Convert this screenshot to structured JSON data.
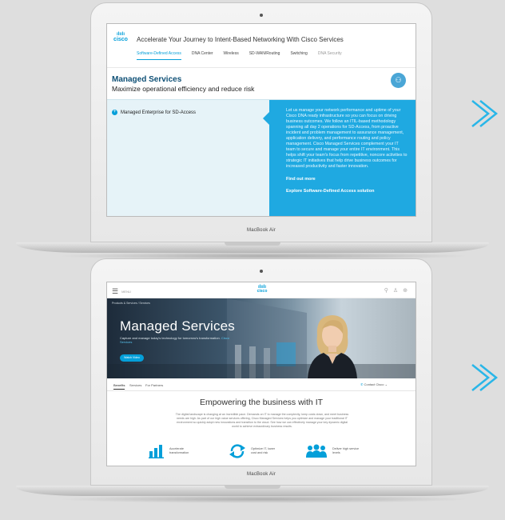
{
  "laptops": [
    {
      "brand": "MacBook Air",
      "screen": {
        "logo_text": "cisco",
        "logo_bars": "ılıılı",
        "title": "Accelerate Your Journey to Intent-Based Networking With Cisco Services",
        "tabs": [
          "Software-Defined Access",
          "DNA Center",
          "Wireless",
          "SD-WAN/Routing",
          "Switching",
          "DNA Security"
        ],
        "heading": "Managed Services",
        "subheading": "Maximize operational efficiency and reduce risk",
        "badge_icon": "people-icon",
        "badge_glyph": "⚇",
        "accordion_item_icon": "+",
        "accordion_item": "Managed Enterprise for SD-Access",
        "description": "Let us manage your network performance and uptime of your Cisco DNA ready infrastructure so you can focus on driving business outcomes. We follow an ITIL-based methodology spanning all day 2 operations for SD-Access, from proactive incident and problem management to assurance management, application delivery, and performance routing and policy management. Cisco Managed Services complement your IT team to secure and manage your entire IT environment. This helps shift your team's focus from repetitive, noncore activities to strategic IT initiatives that help drive business outcomes for increased productivity and faster innovation.",
        "link_find_out": "Find out more",
        "link_explore": "Explore Software-Defined Access solution"
      }
    },
    {
      "brand": "MacBook Air",
      "screen": {
        "menu_glyph": "☰",
        "menu_label": "MENU",
        "logo_text": "cisco",
        "logo_bars": "ılıılı",
        "nav_icons": [
          "⚲",
          "♙",
          "⊕"
        ],
        "breadcrumb": "Products & Services  /  Services",
        "banner_title": "Managed Services",
        "banner_subtitle": "Capture and manage today's technology for tomorrow's transformation.",
        "banner_subtitle_link": "Cisco Services",
        "banner_button": "Watch Video",
        "tabs": [
          "Benefits",
          "Services",
          "For Partners"
        ],
        "contact": "Contact Cisco",
        "section_title": "Empowering the business with IT",
        "section_text": "The digital landscape is changing at an incredible pace. Demands on IT to manage the complexity, keep costs down, and meet business needs are high. As part of our high value services offering, Cisco Managed Services helps you optimize and manage your traditional IT environment so quickly adopt new innovations and transition to the cloud. See how we can effectively manage your key dynamic digital world to achieve extraordinary business results.",
        "features": [
          {
            "icon": "bar-chart-icon",
            "label": "Accelerate transformation"
          },
          {
            "icon": "cycle-arrows-icon",
            "label": "Optimize IT, lower cost and risk"
          },
          {
            "icon": "people-icon",
            "label": "Deliver high service levels"
          }
        ]
      }
    }
  ],
  "chevrons": [
    {
      "icon": "chevron-right-icon"
    },
    {
      "icon": "chevron-right-icon"
    }
  ],
  "colors": {
    "accent": "#049fd9",
    "panel_blue": "#1fa9e1",
    "heading_navy": "#0d4f75",
    "background": "#dedede"
  }
}
